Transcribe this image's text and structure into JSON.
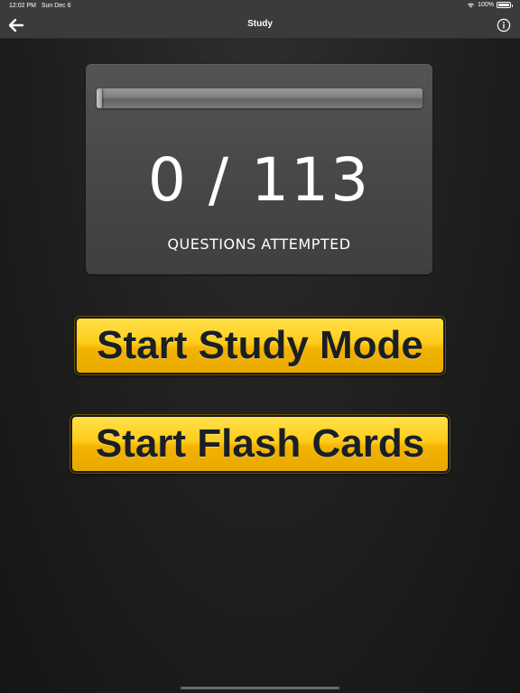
{
  "status_bar": {
    "time": "12:02 PM",
    "date": "Sun Dec 6",
    "battery": "100%",
    "icons": [
      "wifi-icon",
      "battery-icon"
    ]
  },
  "nav": {
    "title": "Study",
    "back_icon": "arrow-left-icon",
    "info_icon": "info-icon"
  },
  "progress": {
    "attempted": 0,
    "total": 113,
    "count_display": "0 / 113",
    "fraction": 0.0,
    "label": "QUESTIONS ATTEMPTED"
  },
  "buttons": {
    "study_mode_label": "Start Study Mode",
    "flash_cards_label": "Start Flash Cards"
  },
  "colors": {
    "button_yellow": "#ffcc1a",
    "button_text": "#1b1f24",
    "nav_background": "#3b3b3b",
    "card_background": "#4a4a4a"
  }
}
